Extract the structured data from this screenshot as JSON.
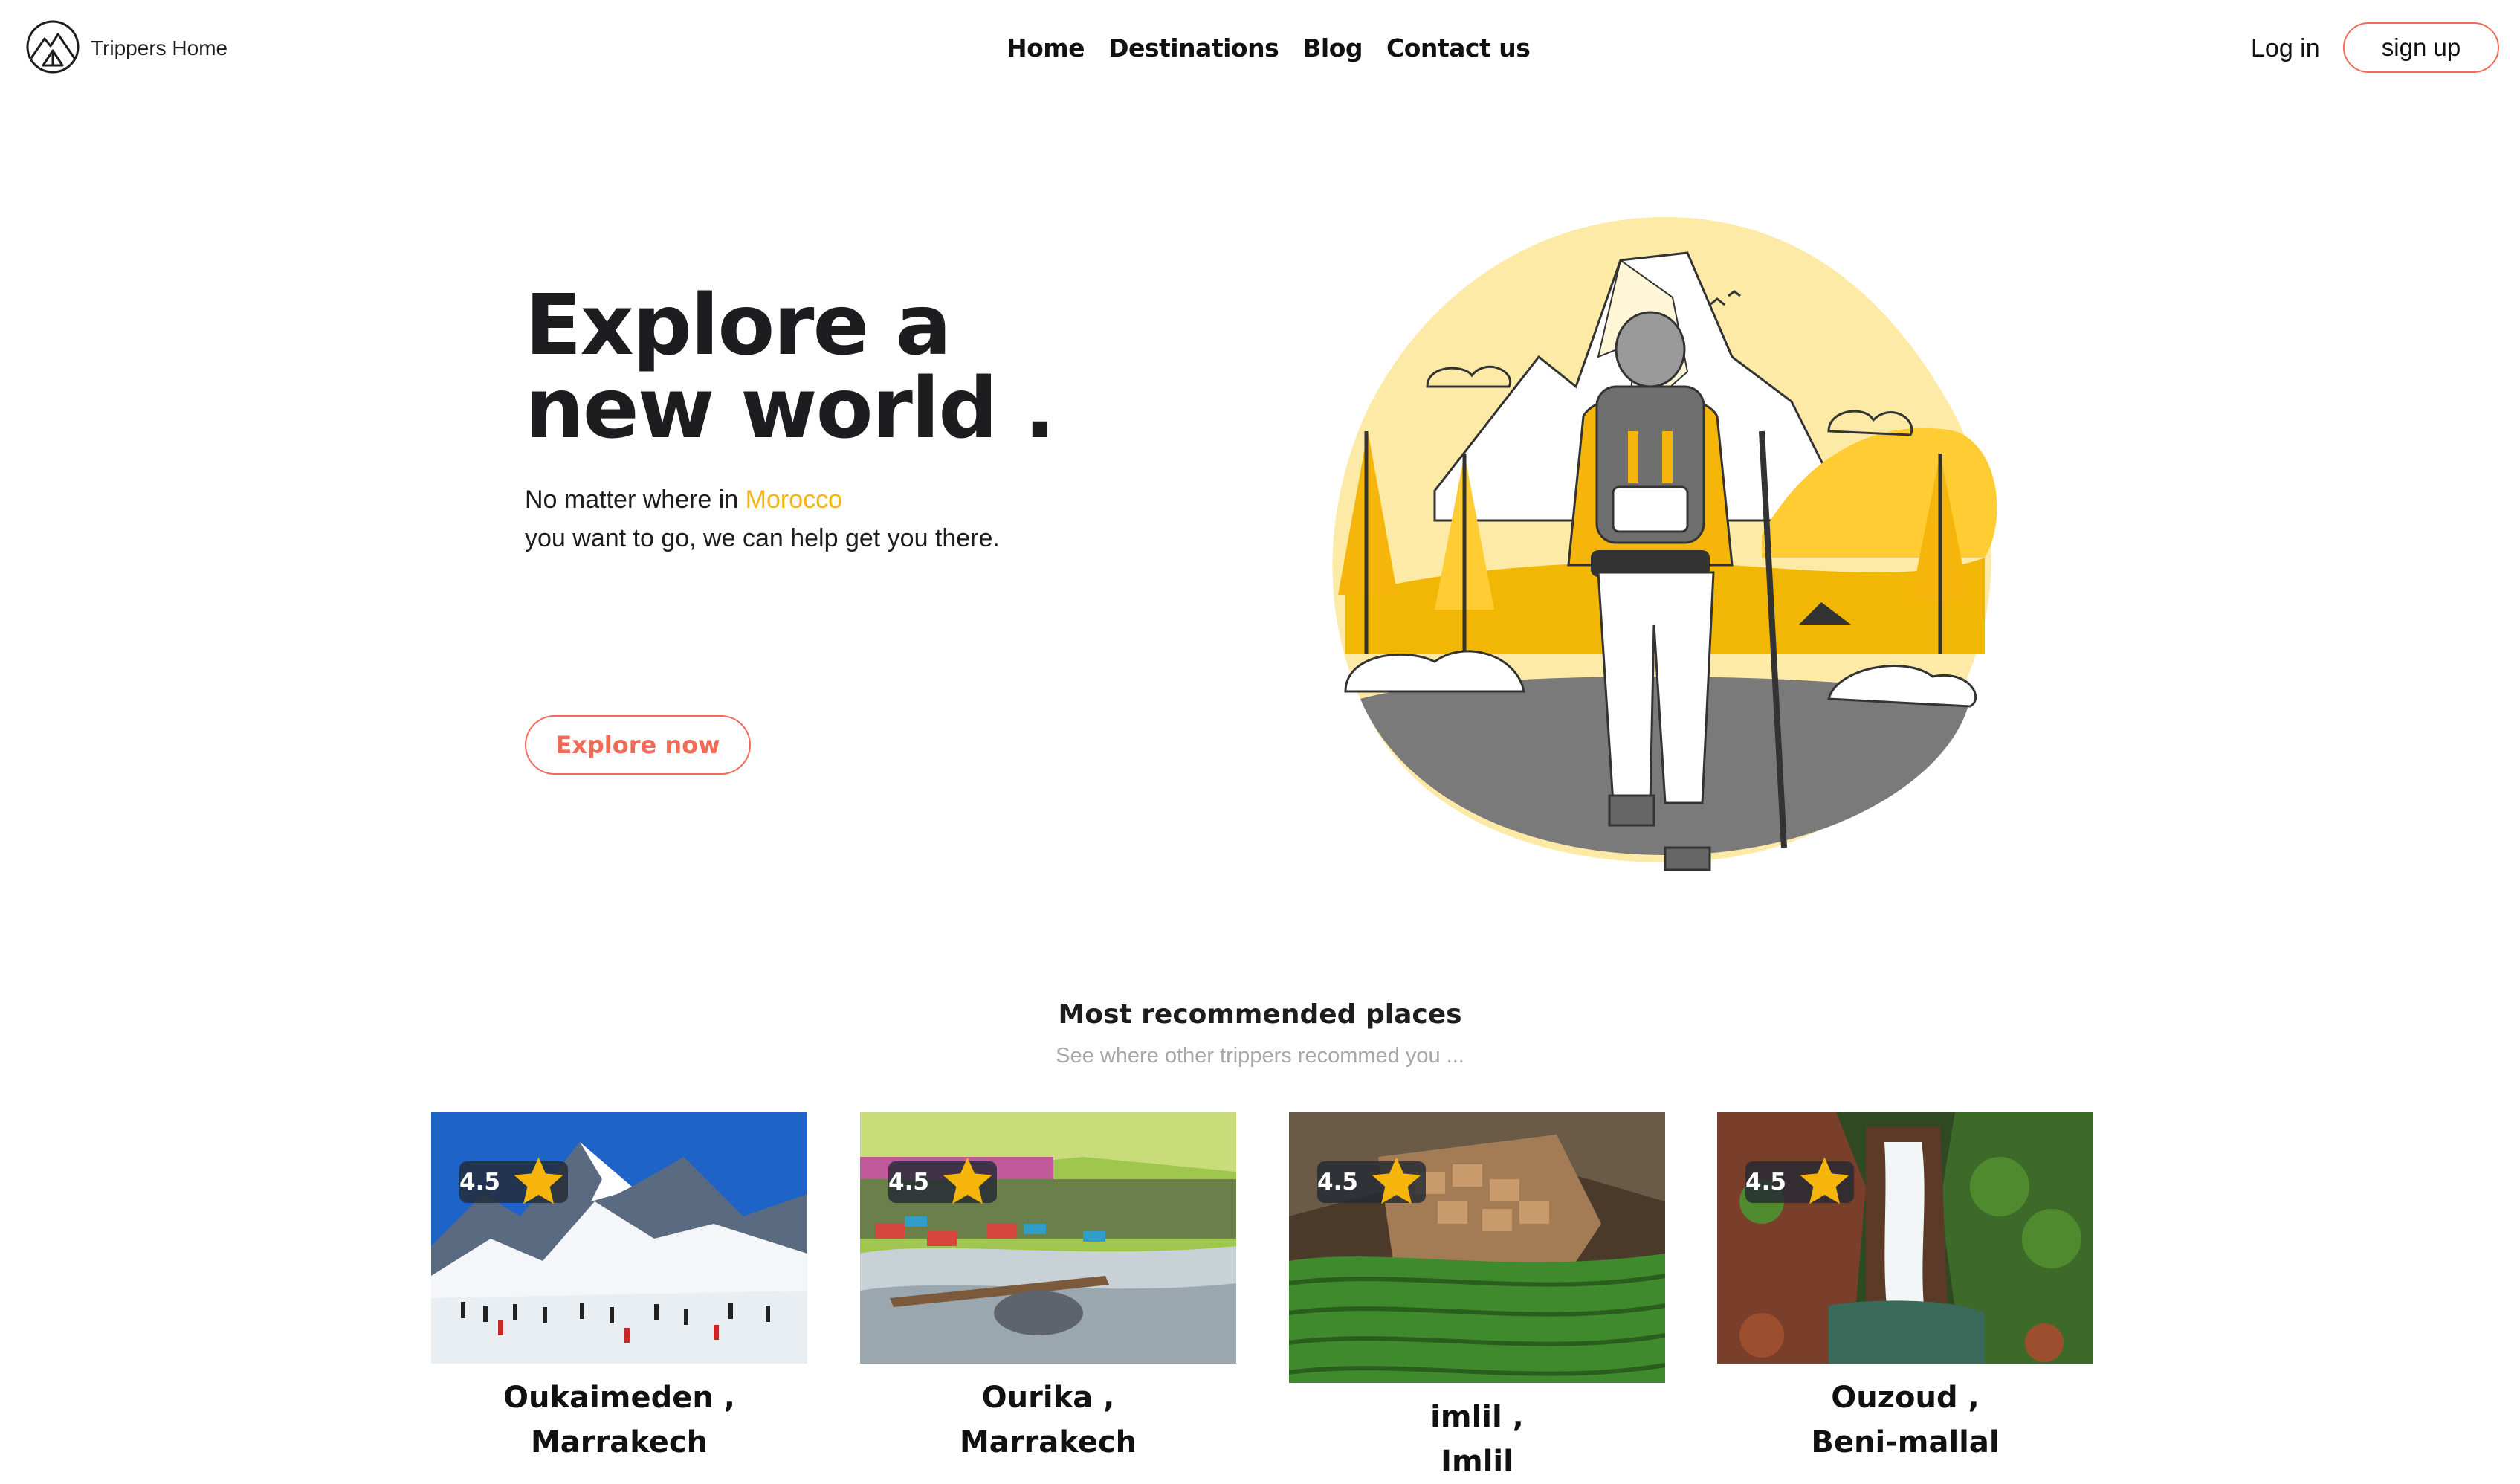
{
  "brand": {
    "name": "Trippers Home",
    "logo_icon": "mountain-tent-logo"
  },
  "nav": {
    "links": [
      "Home",
      "Destinations",
      "Blog",
      "Contact us"
    ],
    "login_label": "Log in",
    "signup_label": "sign up"
  },
  "hero": {
    "title_line1": "Explore a",
    "title_line2": "new world .",
    "subtitle_pre": "No matter where in ",
    "subtitle_accent": "Morocco",
    "subtitle_line2": "you want to go, we can help get you there.",
    "cta_label": "Explore now",
    "illustration": "hiker-mountain-illustration"
  },
  "section": {
    "title": "Most recommended places",
    "subtitle": "See where other trippers recommed you ..."
  },
  "places": [
    {
      "name": "Oukaimeden ,",
      "city": "Marrakech",
      "rating": "4.5",
      "photo": "snowy-mountain-ski-photo"
    },
    {
      "name": "Ourika ,",
      "city": "Marrakech",
      "rating": "4.5",
      "photo": "river-valley-cafes-photo"
    },
    {
      "name": "imlil ,",
      "city": "Imlil",
      "rating": "4.5",
      "photo": "terraced-village-photo"
    },
    {
      "name": "Ouzoud ,",
      "city": "Beni-mallal",
      "rating": "4.5",
      "photo": "waterfall-photo"
    }
  ],
  "colors": {
    "accent_yellow": "#f5b50a",
    "button_border": "#f06a57",
    "muted_text": "#a7a7a7",
    "badge_bg": "#232a34"
  }
}
